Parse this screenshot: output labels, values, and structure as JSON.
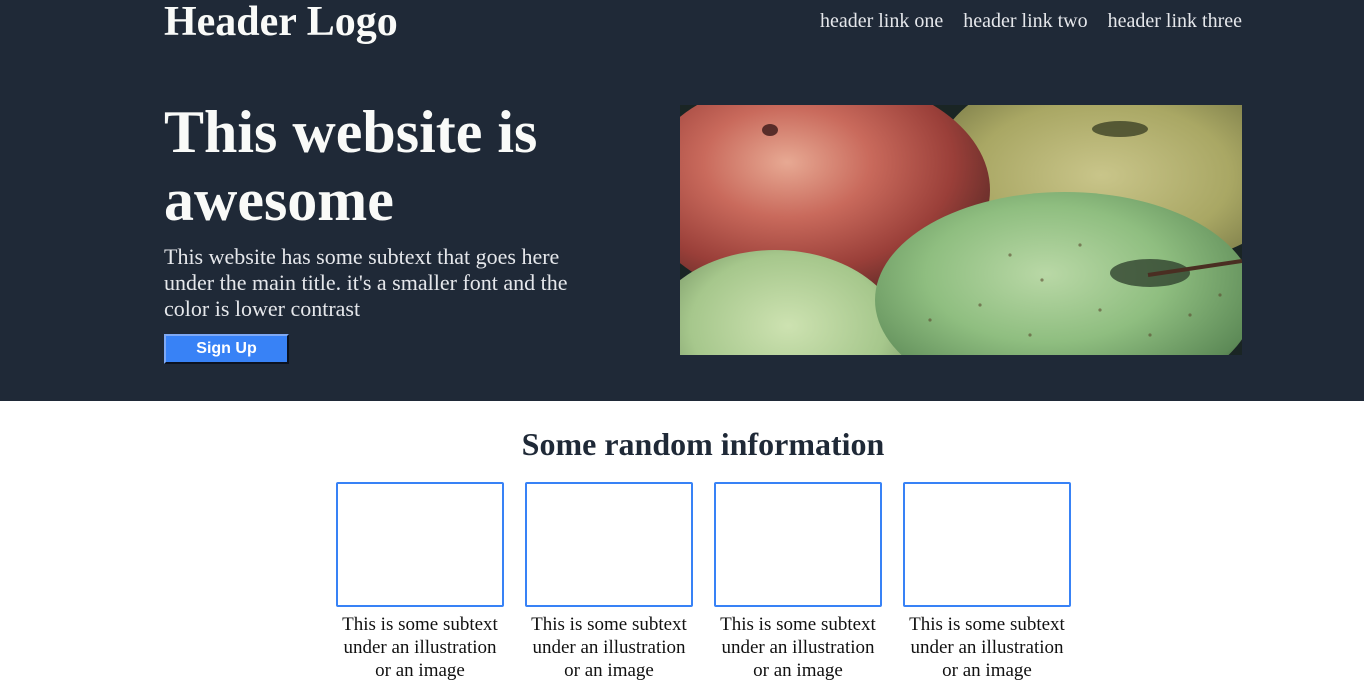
{
  "header": {
    "logo": "Header Logo",
    "links": [
      "header link one",
      "header link two",
      "header link three"
    ]
  },
  "hero": {
    "title": "This website is awesome",
    "subtext": "This website has some subtext that goes here under the main title. it's a smaller font and the color is lower contrast",
    "button_label": "Sign Up",
    "image_subject": "apples photo"
  },
  "info": {
    "title": "Some random information",
    "cards": [
      {
        "text": "This is some subtext under an illustration or an image"
      },
      {
        "text": "This is some subtext under an illustration or an image"
      },
      {
        "text": "This is some subtext under an illustration or an image"
      },
      {
        "text": "This is some subtext under an illustration or an image"
      }
    ]
  },
  "colors": {
    "hero_background": "#1f2937",
    "accent": "#3882f6",
    "heading_text": "#f9faf8",
    "subtext": "#e5e7eb"
  }
}
